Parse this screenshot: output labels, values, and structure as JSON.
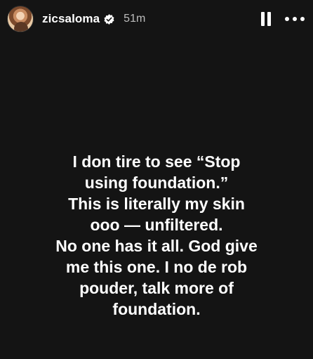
{
  "header": {
    "username": "zicsaloma",
    "timestamp": "51m",
    "avatar_icon": "profile-photo",
    "verified_icon": "verified-badge-icon",
    "pause_icon": "pause-icon",
    "more_icon": "more-icon"
  },
  "story": {
    "text_lines": [
      "I don tire to see “Stop",
      "using foundation.”",
      "This is literally my skin",
      "ooo — unfiltered.",
      "No one has it all. God give",
      "me this one. I no de rob",
      "pouder, talk more of",
      "foundation."
    ]
  },
  "colors": {
    "background": "#141414",
    "text": "#ffffff",
    "timestamp": "#bdbdbd"
  }
}
